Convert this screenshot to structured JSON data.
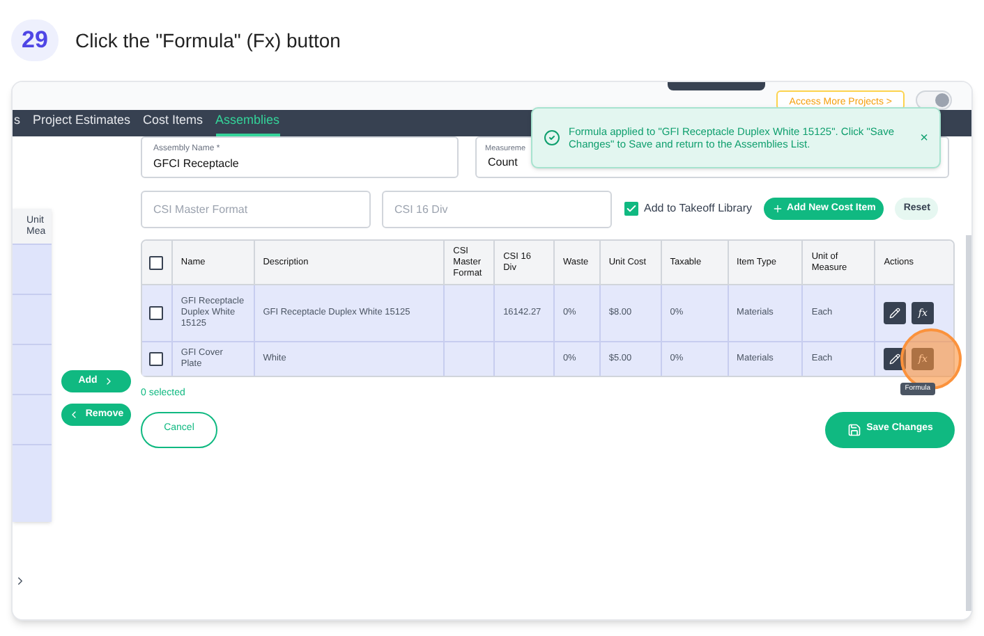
{
  "step": {
    "number": "29",
    "instruction": "Click the \"Formula\" (Fx) button"
  },
  "top_bar": {
    "projects_button": "Access More Projects >",
    "toggle_on": true
  },
  "nav": {
    "tabs": [
      {
        "label": "s",
        "selected": false
      },
      {
        "label": "Project Estimates",
        "selected": false
      },
      {
        "label": "Cost Items",
        "selected": false
      },
      {
        "label": "Assemblies",
        "selected": true
      }
    ]
  },
  "toast": {
    "message": "Formula applied to \"GFI Receptacle Duplex White 15125\". Click \"Save Changes\" to Save and return to the Assemblies List.",
    "close": "×"
  },
  "form": {
    "assembly_name": {
      "label": "Assembly Name *",
      "value": "GFCI Receptacle"
    },
    "measurement": {
      "label": "Measureme",
      "value": "Count"
    }
  },
  "filters": {
    "csi_master": {
      "placeholder": "CSI Master Format"
    },
    "csi_16": {
      "placeholder": "CSI 16 Div"
    },
    "takeoff": {
      "label": "Add to Takeoff Library",
      "checked": true
    },
    "add_button": "Add New Cost Item",
    "reset_button": "Reset"
  },
  "left_panel": {
    "column_label": "Unit Mea"
  },
  "transfer": {
    "add": "Add",
    "remove": "Remove",
    "selection_count": "0 selected"
  },
  "table": {
    "all_selected": false,
    "columns": [
      "Name",
      "Description",
      "CSI Master Format",
      "CSI 16 Div",
      "Waste",
      "Unit Cost",
      "Taxable",
      "Item Type",
      "Unit of Measure",
      "Actions"
    ],
    "rows": [
      {
        "selected": false,
        "highlighted": false,
        "formula_label": "fx",
        "cells": [
          "GFI Receptacle Duplex White 15125",
          "GFI Receptacle Duplex White 15125",
          "",
          "16142.27",
          "0%",
          "$8.00",
          "0%",
          "Materials",
          "Each"
        ]
      },
      {
        "selected": false,
        "highlighted": true,
        "formula_label": "fx",
        "tooltip": "Formula",
        "cells": [
          "GFI Cover Plate",
          "White",
          "",
          "",
          "0%",
          "$5.00",
          "0%",
          "Materials",
          "Each"
        ]
      }
    ]
  },
  "buttons": {
    "cancel": "Cancel",
    "save": "Save Changes"
  }
}
